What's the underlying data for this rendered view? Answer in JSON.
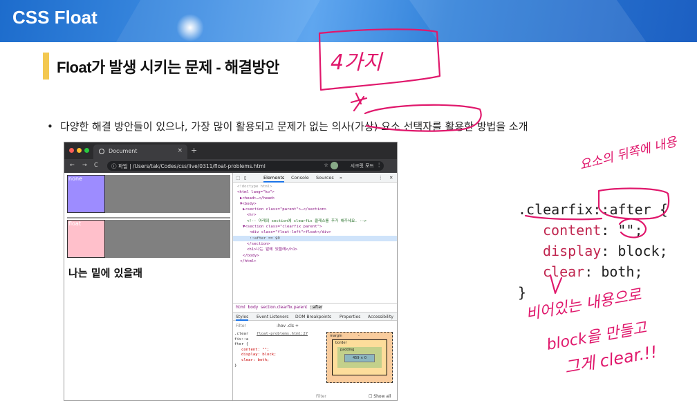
{
  "slide": {
    "title": "CSS Float",
    "subtitle": "Float가 발생 시키는 문제 - 해결방안",
    "bullet": "다양한 해결 방안들이 있으나, 가장 많이 활용되고 문제가 없는 의사(가상) 요소 선택자를 활용한 방법을 소개",
    "bullet_marker": "•"
  },
  "browser": {
    "tab_title": "Document",
    "tab_close": "×",
    "new_tab": "+",
    "nav": {
      "back": "←",
      "forward": "→",
      "reload": "C",
      "info": "ⓘ"
    },
    "url_prefix": "파일",
    "url": "/Users/tak/Codes/css/live/0311/float-problems.html",
    "star": "☆",
    "secret_mode": "시크릿 모드",
    "menu": "⋮",
    "page": {
      "box1_label": "none",
      "box2_label": "float",
      "text": "나는 밑에 있을래"
    },
    "devtools": {
      "tabs": [
        "Elements",
        "Console",
        "Sources",
        "»"
      ],
      "dom": [
        "<!doctype html>",
        "<html lang=\"ko\">",
        "▶<head>…</head>",
        "▼<body>",
        "▶<section class=\"parent\">…</section>",
        "<hr>",
        "<!-- 아래의 section에 clearfix 클래스를 추가 해주세요. -->",
        "▼<section class=\"clearfix parent\">",
        "<div class=\"float-left\">float</div>",
        "::after == $0",
        "</section>",
        "<h1>나는 밑에 있을래</h1>",
        "</body>",
        "</html>"
      ],
      "breadcrumbs": [
        "html",
        "body",
        "section.clearfix.parent",
        "::after"
      ],
      "style_tabs": [
        "Styles",
        "Event Listeners",
        "DOM Breakpoints",
        "Properties",
        "Accessibility"
      ],
      "filter": "Filter",
      "hov_cls": ":hov .cls +",
      "rule_selector": ".clear fix::a fter {",
      "rule_link": "float-problems.html:27",
      "rule_lines": [
        "content: \"\";",
        "display: block;",
        "clear: both;",
        "}"
      ],
      "boxmodel": {
        "margin": "margin",
        "border": "border",
        "padding": "padding",
        "content": "459 × 0",
        "dash": "-"
      },
      "filter2": "Filter",
      "show_all": "Show all"
    }
  },
  "code_panel": {
    "selector": ".clearfix::after {",
    "lines": [
      {
        "prop": "content",
        "value": "\"\";"
      },
      {
        "prop": "display",
        "value": "block;"
      },
      {
        "prop": "clear",
        "value": "both;"
      }
    ],
    "close": "}"
  },
  "annotations": {
    "note1": "4가지",
    "note2": "요소의 뒤쪽에 내용",
    "note3": "비어있는 내용으로",
    "note4": "block을 만들고",
    "note5": "그게 clear.!!"
  },
  "colors": {
    "header": "#2f7fd8",
    "accent": "#f3c850",
    "ink": "#e0186c",
    "box_none": "#9d8cff",
    "box_float": "#ffc0cb",
    "gray": "#808080"
  }
}
